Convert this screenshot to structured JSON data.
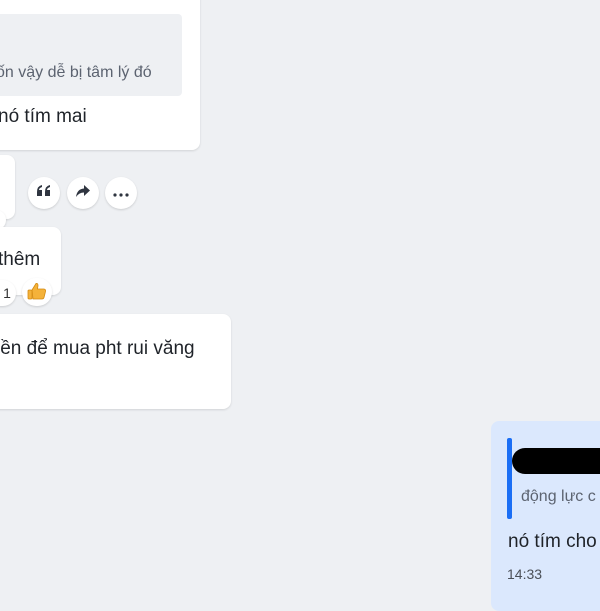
{
  "messages": [
    {
      "quote_text": "ốn vậy dễ bị tâm lý đó",
      "text": "nó tím mai"
    },
    {
      "text": "thêm",
      "reaction_count": "1"
    },
    {
      "text": "iền để mua pht rui văng"
    }
  ],
  "my_message": {
    "quote_text": "động lực c",
    "text": "nó tím cho",
    "time": "14:33"
  },
  "actions": {
    "quote_icon": "quote-icon",
    "forward_icon": "forward-icon",
    "more_icon": "more-icon"
  },
  "colors": {
    "background": "#eef0f3",
    "my_bubble": "#dbe8fd",
    "quote_bar": "#1a6ef5"
  }
}
